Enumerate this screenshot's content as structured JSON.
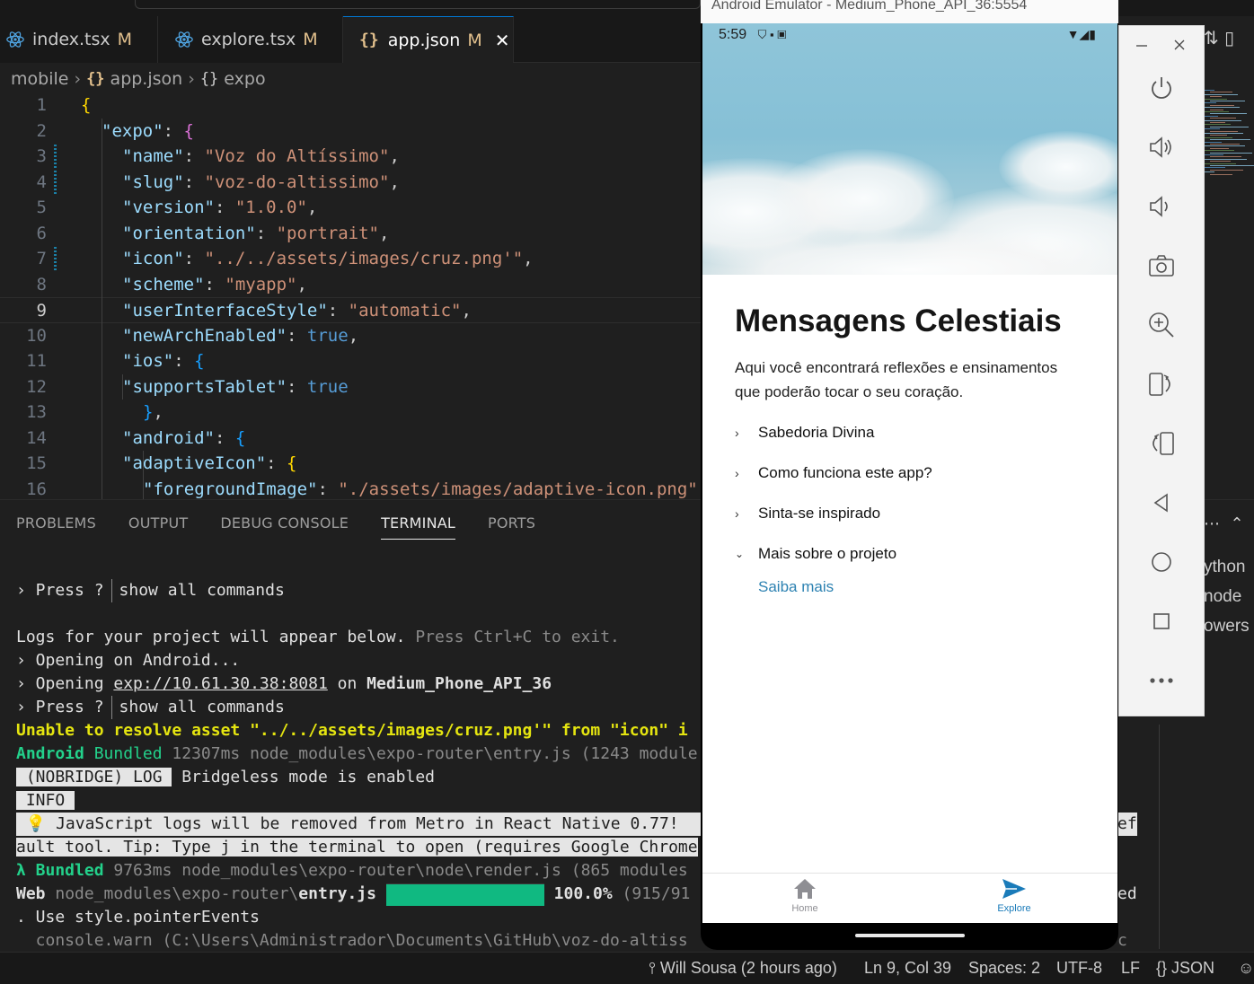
{
  "tabs": [
    {
      "label": "index.tsx",
      "modified": "M"
    },
    {
      "label": "explore.tsx",
      "modified": "M"
    },
    {
      "label": "app.json",
      "modified": "M",
      "active": true
    }
  ],
  "breadcrumb": {
    "root": "mobile",
    "file": "app.json",
    "node": "expo"
  },
  "editor": {
    "lines": [
      {
        "n": "1",
        "tokens": [
          [
            "br1",
            "{"
          ]
        ]
      },
      {
        "n": "2",
        "tokens": [
          [
            "k",
            "\"expo\""
          ],
          [
            "p",
            ": "
          ],
          [
            "br2",
            "{"
          ]
        ]
      },
      {
        "n": "3",
        "tokens": [
          [
            "k",
            "\"name\""
          ],
          [
            "p",
            ": "
          ],
          [
            "s",
            "\"Voz do Altíssimo\""
          ],
          [
            "p",
            ","
          ]
        ]
      },
      {
        "n": "4",
        "tokens": [
          [
            "k",
            "\"slug\""
          ],
          [
            "p",
            ": "
          ],
          [
            "s",
            "\"voz-do-altissimo\""
          ],
          [
            "p",
            ","
          ]
        ]
      },
      {
        "n": "5",
        "tokens": [
          [
            "k",
            "\"version\""
          ],
          [
            "p",
            ": "
          ],
          [
            "s",
            "\"1.0.0\""
          ],
          [
            "p",
            ","
          ]
        ]
      },
      {
        "n": "6",
        "tokens": [
          [
            "k",
            "\"orientation\""
          ],
          [
            "p",
            ": "
          ],
          [
            "s",
            "\"portrait\""
          ],
          [
            "p",
            ","
          ]
        ]
      },
      {
        "n": "7",
        "tokens": [
          [
            "k",
            "\"icon\""
          ],
          [
            "p",
            ": "
          ],
          [
            "s",
            "\"../../assets/images/cruz.png'\""
          ],
          [
            "p",
            ","
          ]
        ]
      },
      {
        "n": "8",
        "tokens": [
          [
            "k",
            "\"scheme\""
          ],
          [
            "p",
            ": "
          ],
          [
            "s",
            "\"myapp\""
          ],
          [
            "p",
            ","
          ]
        ]
      },
      {
        "n": "9",
        "tokens": [
          [
            "k",
            "\"userInterfaceStyle\""
          ],
          [
            "p",
            ": "
          ],
          [
            "s",
            "\"automatic\""
          ],
          [
            "p",
            ","
          ]
        ]
      },
      {
        "n": "10",
        "tokens": [
          [
            "k",
            "\"newArchEnabled\""
          ],
          [
            "p",
            ": "
          ],
          [
            "b",
            "true"
          ],
          [
            "p",
            ","
          ]
        ]
      },
      {
        "n": "11",
        "tokens": [
          [
            "k",
            "\"ios\""
          ],
          [
            "p",
            ": "
          ],
          [
            "br3",
            "{"
          ]
        ]
      },
      {
        "n": "12",
        "tokens": [
          [
            "k",
            "\"supportsTablet\""
          ],
          [
            "p",
            ": "
          ],
          [
            "b",
            "true"
          ]
        ]
      },
      {
        "n": "13",
        "tokens": [
          [
            "br3",
            "}"
          ],
          [
            "p",
            ","
          ]
        ]
      },
      {
        "n": "14",
        "tokens": [
          [
            "k",
            "\"android\""
          ],
          [
            "p",
            ": "
          ],
          [
            "br3",
            "{"
          ]
        ]
      },
      {
        "n": "15",
        "tokens": [
          [
            "k",
            "\"adaptiveIcon\""
          ],
          [
            "p",
            ": "
          ],
          [
            "br1",
            "{"
          ]
        ]
      },
      {
        "n": "16",
        "tokens": [
          [
            "k",
            "\"foregroundImage\""
          ],
          [
            "p",
            ": "
          ],
          [
            "s",
            "\"./assets/images/adaptive-icon.png\""
          ]
        ]
      }
    ],
    "current_line": "9"
  },
  "panel": {
    "tabs": [
      "PROBLEMS",
      "OUTPUT",
      "DEBUG CONSOLE",
      "TERMINAL",
      "PORTS"
    ],
    "active_tab": "TERMINAL",
    "terminal": {
      "l1_prefix": "› Press ?",
      "l1_rest": "show all commands",
      "l2a": "Logs for your project will appear below.",
      "l2b": " Press Ctrl+C to exit.",
      "l3": "› Opening on Android...",
      "l4a": "› Opening ",
      "l4b": "exp://10.61.30.38:8081",
      "l4c": " on ",
      "l4d": "Medium_Phone_API_36",
      "l5_prefix": "› Press ?",
      "l5_rest": "show all commands",
      "l6": "Unable to resolve asset \"../../assets/images/cruz.png'\" from \"icon\" i",
      "l7a": "Android",
      "l7b": " Bundled",
      "l7c": " 12307ms",
      "l7d": " node_modules\\expo-router\\entry.js",
      "l7e": " (1243 module",
      "l8a": " (NOBRIDGE) LOG ",
      "l8b": " Bridgeless mode is enabled",
      "l9": " INFO ",
      "l10": " 💡 JavaScript logs will be removed from Metro in React Native 0.77! ",
      "l10_tail": "ef",
      "l11": "ault tool. Tip: Type j in the terminal to open (requires Google Chrome",
      "l12a": "λ Bundled",
      "l12b": " 9763ms",
      "l12c": " node_modules\\expo-router\\node\\render.js",
      "l12d": " (865 modules",
      "l13a": "Web",
      "l13b": " node_modules\\expo-router\\",
      "l13c": "entry.js",
      "l13d": "100.0%",
      "l13e": " (915/91",
      "l13_tail": "ed",
      "l14": ". Use style.pointerEvents",
      "l15": "  console.warn (C:\\Users\\Administrador\\Documents\\GitHub\\voz-do-altiss",
      "l15_tail": "c",
      "progress_fraction": 1.0
    },
    "right_snippets": [
      "ython",
      "node",
      "owers"
    ]
  },
  "statusbar": {
    "git_blame": "Will Sousa (2 hours ago)",
    "cursor": "Ln 9, Col 39",
    "spaces": "Spaces: 2",
    "encoding": "UTF-8",
    "eol": "LF",
    "language": "JSON"
  },
  "emulator": {
    "title": "Android Emulator - Medium_Phone_API_36:5554",
    "status_time": "5:59",
    "app": {
      "title": "Mensagens Celestiais",
      "description": "Aqui você encontrará reflexões e ensinamentos que poderão tocar o seu coração.",
      "collapsibles": [
        {
          "label": "Sabedoria Divina",
          "open": false
        },
        {
          "label": "Como funciona este app?",
          "open": false
        },
        {
          "label": "Sinta-se inspirado",
          "open": false
        },
        {
          "label": "Mais sobre o projeto",
          "open": true
        }
      ],
      "link": "Saiba mais",
      "nav": [
        {
          "label": "Home",
          "icon": "home-icon",
          "active": false
        },
        {
          "label": "Explore",
          "icon": "paper-plane-icon",
          "active": true
        }
      ],
      "accent": "#2d82b2",
      "nav_active_color": "#1a7bb9"
    },
    "toolbar": [
      "minimize",
      "close",
      "power",
      "volume-up",
      "volume-down",
      "camera",
      "zoom",
      "rotate-right",
      "rotate-left",
      "back",
      "home",
      "overview",
      "more"
    ]
  }
}
